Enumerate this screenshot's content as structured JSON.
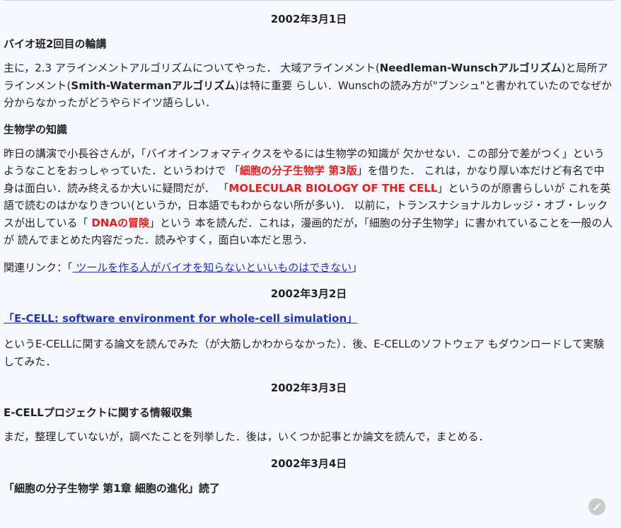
{
  "entries": [
    {
      "date": "2002年3月1日",
      "sections": [
        {
          "heading": "バイオ班2回目の輪講",
          "p1_a": "主に，2.3 アラインメントアルゴリズムについてやった．  大域アラインメント(",
          "p1_b": "Needleman-Wunschアルゴリズム",
          "p1_c": ")と局所アラインメント(",
          "p1_d": "Smith-Watermanアルゴリズム",
          "p1_e": ")は特に重要 らしい．Wunschの読み方が\"ブンシュ\"と書かれていたのでなぜか 分からなかったがどうやらドイツ語らしい．"
        },
        {
          "heading": "生物学の知識",
          "p_a": "昨日の講演で小長谷さんが，「バイオインフォマティクスをやるには生物学の知識が 欠かせない．この部分で差がつく」というようなことをおっしゃっていた．というわけで 「",
          "p_b": "細胞の分子生物学 第3版",
          "p_c": "」を借りた． これは，かなり厚い本だけど有名で中身は面白い．読み終えるか大いに疑問だが． 「",
          "p_d": "MOLECULAR BIOLOGY OF THE CELL",
          "p_e": "」というのが原書らしいが これを英語で読むのはかなりきつい(というか，日本語でもわからない所が多い)． 以前に，トランスナショナルカレッジ・オブ・レックスが出している「 ",
          "p_f": "DNAの冒険",
          "p_g": "」という 本を読んだ．これは，漫画的だが，「細胞の分子生物学」に書かれていることを一般の人が 読んでまとめた内容だった．読みやすく，面白い本だと思う．",
          "related_prefix": "関連リンク：「",
          "related_link": " ツールを作る人がバイオを知らないといいものはできない",
          "related_suffix": "」"
        }
      ]
    },
    {
      "date": "2002年3月2日",
      "title_link": "「E-CELL: software environment for whole-cell simulation」",
      "para": "というE-CELLに関する論文を読んでみた（が大筋しかわからなかった）．後、E-CELLのソフトウェア もダウンロードして実験してみた．"
    },
    {
      "date": "2002年3月3日",
      "heading": "E-CELLプロジェクトに関する情報収集",
      "para": "まだ，整理していないが，調べたことを列挙した．後は，いくつか記事とか論文を読んで，まとめる．"
    },
    {
      "date": "2002年3月4日",
      "heading": "「細胞の分子生物学 第1章 細胞の進化」読了"
    }
  ],
  "fab_icon": "edit-icon"
}
